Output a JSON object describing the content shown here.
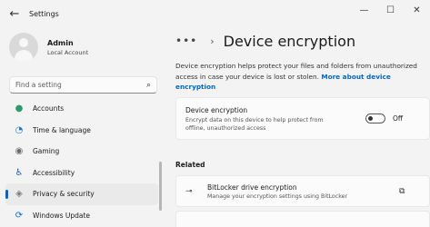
{
  "window": {
    "title": "Settings",
    "back_icon": "arrow-left-icon",
    "controls": {
      "minimize": "—",
      "maximize": "☐",
      "close": "✕"
    }
  },
  "profile": {
    "name": "Admin",
    "account_type": "Local Account"
  },
  "search": {
    "placeholder": "Find a setting"
  },
  "sidebar": {
    "items": [
      {
        "label": "Accounts",
        "icon": "person-icon",
        "color": "#2e9b6e",
        "glyph": "●"
      },
      {
        "label": "Time & language",
        "icon": "globe-clock-icon",
        "color": "#2a74c7",
        "glyph": "◔"
      },
      {
        "label": "Gaming",
        "icon": "game-controller-icon",
        "color": "#6b6b6b",
        "glyph": "◉"
      },
      {
        "label": "Accessibility",
        "icon": "accessibility-icon",
        "color": "#1f5fa8",
        "glyph": "♿"
      },
      {
        "label": "Privacy & security",
        "icon": "shield-icon",
        "color": "#7a7a7a",
        "glyph": "◈"
      },
      {
        "label": "Windows Update",
        "icon": "windows-update-icon",
        "color": "#0a6ed1",
        "glyph": "⟳"
      }
    ],
    "selected_index": 4
  },
  "main": {
    "breadcrumb_more": "•••",
    "breadcrumb_separator": "›",
    "page_title": "Device encryption",
    "description": "Device encryption helps protect your files and folders from unauthorized access in case your device is lost or stolen. ",
    "description_link": "More about device encryption",
    "encryption_card": {
      "title": "Device encryption",
      "subtitle": "Encrypt data on this device to help protect from offline, unauthorized access",
      "toggle_state": "Off"
    },
    "related_heading": "Related",
    "bitlocker_card": {
      "icon": "key-icon",
      "title": "BitLocker drive encryption",
      "subtitle": "Manage your encryption settings using BitLocker",
      "external_icon": "open-external-icon"
    }
  },
  "colors": {
    "accent": "#0067c0",
    "background": "#f3f3f3",
    "card": "#fbfbfb"
  }
}
